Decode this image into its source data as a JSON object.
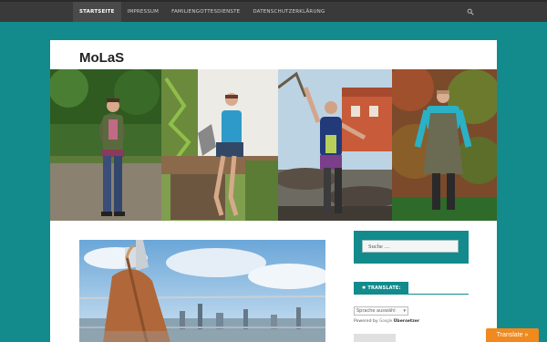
{
  "nav": {
    "items": [
      "STARTSEITE",
      "IMPRESSUM",
      "FAMILIENGOTTESDIENSTE",
      "DATENSCHUTZERKLÄRUNG"
    ],
    "active_index": 0
  },
  "site": {
    "title": "MoLaS"
  },
  "sidebar": {
    "search_placeholder": "Suche …",
    "translate_title": "✱ TRANSLATE:",
    "language_select": "Sprache auswähl",
    "powered_by_prefix": "Powered by",
    "google_word": "Google",
    "powered_by_service": "Übersetzer"
  },
  "floating": {
    "translate_button": "Translate »"
  },
  "colors": {
    "teal": "#138b8c",
    "nav_bg": "#3a3a3a",
    "orange": "#f0891e"
  }
}
